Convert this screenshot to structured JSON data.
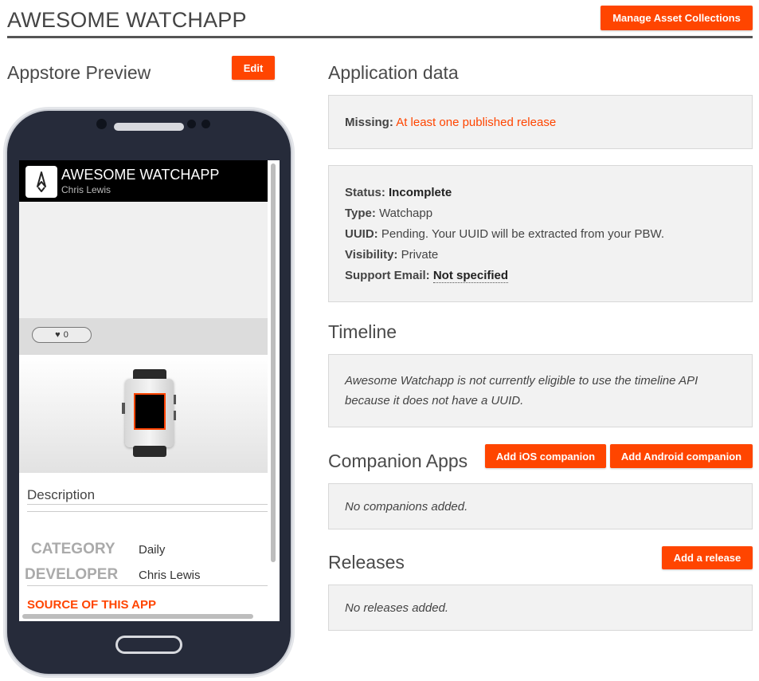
{
  "header": {
    "title": "AWESOME WATCHAPP",
    "manage_button": "Manage Asset Collections"
  },
  "preview": {
    "heading": "Appstore Preview",
    "edit_button": "Edit",
    "app_name": "AWESOME WATCHAPP",
    "author": "Chris Lewis",
    "hearts": "0",
    "description_label": "Description",
    "category_label": "CATEGORY",
    "category_value": "Daily",
    "developer_label": "DEVELOPER",
    "developer_value": "Chris Lewis",
    "source_link": "SOURCE OF THIS APP"
  },
  "application_data": {
    "heading": "Application data",
    "missing_label": "Missing:",
    "missing_value": "At least one published release",
    "status_label": "Status:",
    "status_value": "Incomplete",
    "type_label": "Type:",
    "type_value": "Watchapp",
    "uuid_label": "UUID:",
    "uuid_value": "Pending. Your UUID will be extracted from your PBW.",
    "visibility_label": "Visibility:",
    "visibility_value": "Private",
    "support_label": "Support Email:",
    "support_value": "Not specified"
  },
  "timeline": {
    "heading": "Timeline",
    "message_line1": "Awesome Watchapp is not currently eligible to use the timeline API",
    "message_line2": "because it does not have a UUID."
  },
  "companion": {
    "heading": "Companion Apps",
    "ios_button": "Add iOS companion",
    "android_button": "Add Android companion",
    "empty": "No companions added."
  },
  "releases": {
    "heading": "Releases",
    "add_button": "Add a release",
    "empty": "No releases added."
  },
  "colors": {
    "accent": "#ff4500",
    "phone_body": "#262b3a",
    "panel_bg": "#f2f2f2"
  }
}
